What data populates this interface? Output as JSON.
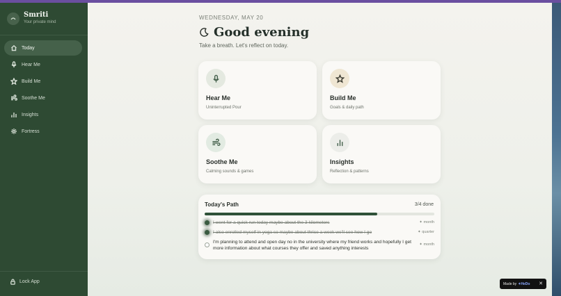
{
  "app": {
    "name": "Smriti",
    "subtitle": "Your private mind"
  },
  "sidebar": {
    "items": [
      {
        "label": "Today",
        "icon": "home-icon",
        "active": true
      },
      {
        "label": "Hear Me",
        "icon": "microphone-icon"
      },
      {
        "label": "Build Me",
        "icon": "star-icon"
      },
      {
        "label": "Soothe Me",
        "icon": "wind-icon"
      },
      {
        "label": "Insights",
        "icon": "bar-chart-icon"
      },
      {
        "label": "Fortress",
        "icon": "gear-icon"
      }
    ],
    "lock_label": "Lock App"
  },
  "header": {
    "date": "WEDNESDAY, MAY 20",
    "greeting": "Good evening",
    "tagline": "Take a breath. Let's reflect on today."
  },
  "cards": [
    {
      "title": "Hear Me",
      "subtitle": "Uninterrupted Pour",
      "icon": "microphone-icon"
    },
    {
      "title": "Build Me",
      "subtitle": "Goals & daily path",
      "icon": "star-icon"
    },
    {
      "title": "Soothe Me",
      "subtitle": "Calming sounds & games",
      "icon": "wind-icon"
    },
    {
      "title": "Insights",
      "subtitle": "Reflection & patterns",
      "icon": "bar-chart-icon"
    }
  ],
  "path": {
    "title": "Today's Path",
    "count": "3/4 done",
    "progress": 0.75,
    "tasks": [
      {
        "text": "I went for a quick run today maybe about the 3 kilometers",
        "tag": "✦ month",
        "done": true
      },
      {
        "text": "I also enrolled myself in yoga so maybe about thrice a week we'll see how I go",
        "tag": "✦ quarter",
        "done": true
      },
      {
        "text": "I'm planning to attend and open day no in the university where my friend works and hopefully I get more information about what courses they offer and saved anything interests",
        "tag": "✦ month",
        "done": false
      }
    ]
  },
  "badge": {
    "prefix": "Made by",
    "brand": "✦HeDo",
    "close": "✕"
  },
  "colors": {
    "sidebar": "#2e4a33",
    "accent": "#2f5138",
    "purple_bar": "#6b4fa0"
  }
}
